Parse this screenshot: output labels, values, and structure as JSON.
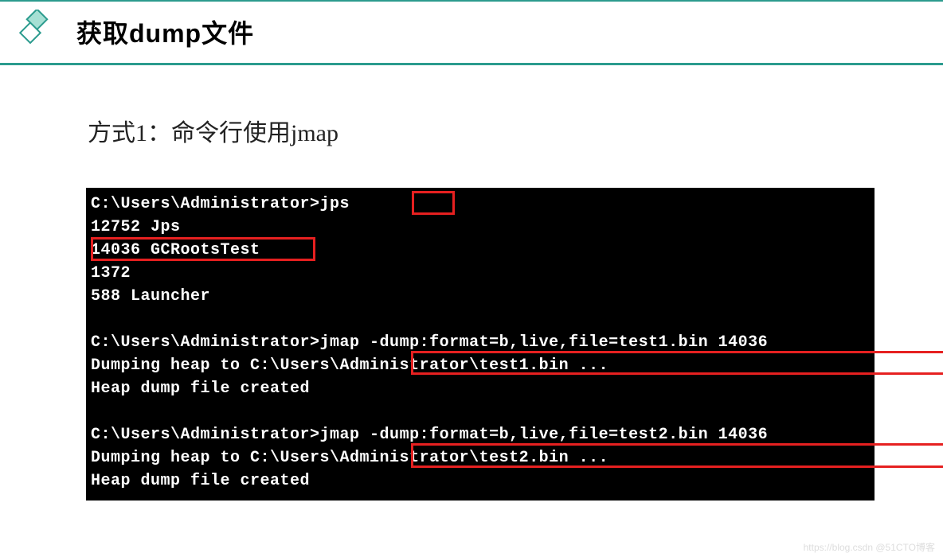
{
  "header": {
    "title": "获取dump文件"
  },
  "subtitle": "方式1：命令行使用jmap",
  "terminal": {
    "l1_prompt": "C:\\Users\\Administrator>",
    "l1_cmd": "jps",
    "l2": "12752 Jps",
    "l3": "14036 GCRootsTest",
    "l4": "1372",
    "l5": "588 Launcher",
    "blank1": " ",
    "l6_prompt": "C:\\Users\\Administrator>",
    "l6_cmd": "jmap -dump:format=b,live,file=test1.bin 14036",
    "l7": "Dumping heap to C:\\Users\\Administrator\\test1.bin ...",
    "l8": "Heap dump file created",
    "blank2": " ",
    "l9_prompt": "C:\\Users\\Administrator>",
    "l9_cmd": "jmap -dump:format=b,live,file=test2.bin 14036",
    "l10": "Dumping heap to C:\\Users\\Administrator\\test2.bin ...",
    "l11": "Heap dump file created"
  },
  "watermark": "https://blog.csdn @51CTO博客"
}
